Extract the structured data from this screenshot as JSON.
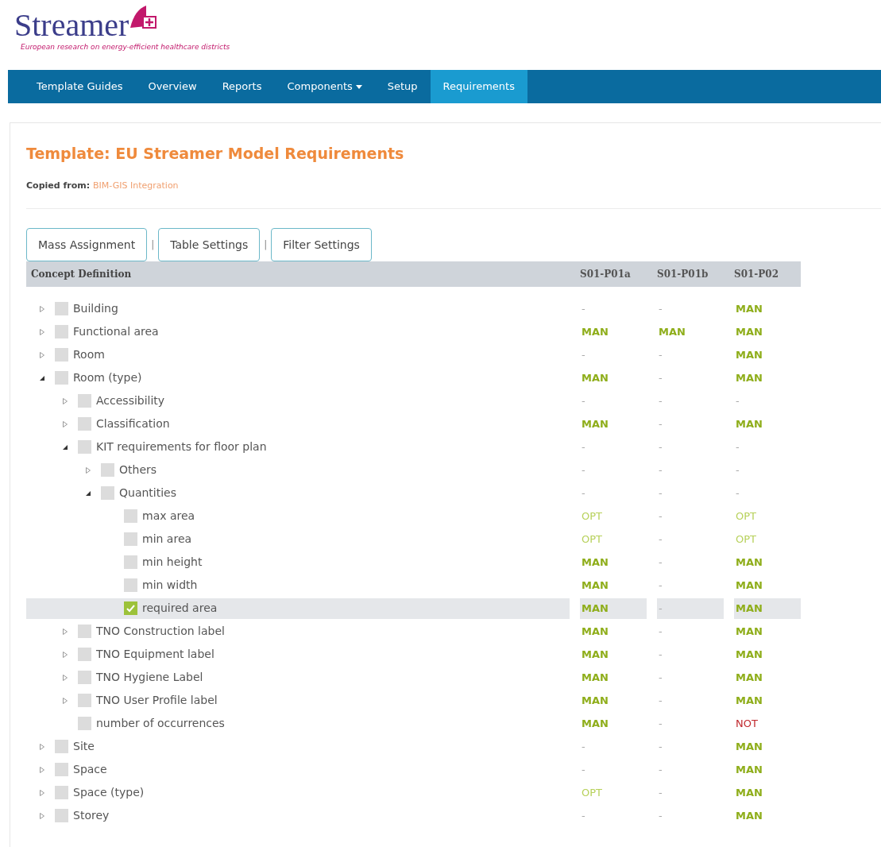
{
  "logo": {
    "name": "Streamer",
    "tagline": "European research on energy-efficient healthcare districts"
  },
  "nav": [
    {
      "label": "Template Guides",
      "selected": false,
      "dropdown": false
    },
    {
      "label": "Overview",
      "selected": false,
      "dropdown": false
    },
    {
      "label": "Reports",
      "selected": false,
      "dropdown": false
    },
    {
      "label": "Components",
      "selected": false,
      "dropdown": true
    },
    {
      "label": "Setup",
      "selected": false,
      "dropdown": false
    },
    {
      "label": "Requirements",
      "selected": true,
      "dropdown": false
    }
  ],
  "title": "Template: EU Streamer Model Requirements",
  "copied_from": {
    "label": "Copied from:",
    "value": "BIM-GIS Integration"
  },
  "buttons": [
    "Mass Assignment",
    "Table Settings",
    "Filter Settings"
  ],
  "separators": [
    "|",
    "|"
  ],
  "table": {
    "columns": [
      "Concept Definition",
      "S01-P01a",
      "S01-P01b",
      "S01-P02"
    ],
    "rows": [
      {
        "name": "Building",
        "kind": "branch",
        "expanded": false,
        "checked": false,
        "selected": false,
        "values": [
          {
            "text": "-",
            "kind": "none"
          },
          {
            "text": "-",
            "kind": "none"
          },
          {
            "text": "MAN",
            "kind": "man"
          }
        ]
      },
      {
        "name": "Functional area",
        "kind": "branch",
        "expanded": false,
        "checked": false,
        "selected": false,
        "values": [
          {
            "text": "MAN",
            "kind": "man"
          },
          {
            "text": "MAN",
            "kind": "man"
          },
          {
            "text": "MAN",
            "kind": "man"
          }
        ]
      },
      {
        "name": "Room",
        "kind": "branch",
        "expanded": false,
        "checked": false,
        "selected": false,
        "values": [
          {
            "text": "-",
            "kind": "none"
          },
          {
            "text": "-",
            "kind": "none"
          },
          {
            "text": "MAN",
            "kind": "man"
          }
        ]
      },
      {
        "name": "Room (type)",
        "kind": "branch",
        "expanded": true,
        "checked": false,
        "selected": false,
        "values": [
          {
            "text": "MAN",
            "kind": "man"
          },
          {
            "text": "-",
            "kind": "none"
          },
          {
            "text": "MAN",
            "kind": "man"
          }
        ],
        "children": [
          {
            "name": "Accessibility",
            "kind": "branch",
            "expanded": false,
            "checked": false,
            "selected": false,
            "values": [
              {
                "text": "-",
                "kind": "none"
              },
              {
                "text": "-",
                "kind": "none"
              },
              {
                "text": "-",
                "kind": "none"
              }
            ]
          },
          {
            "name": "Classification",
            "kind": "branch",
            "expanded": false,
            "checked": false,
            "selected": false,
            "values": [
              {
                "text": "MAN",
                "kind": "man"
              },
              {
                "text": "-",
                "kind": "none"
              },
              {
                "text": "MAN",
                "kind": "man"
              }
            ]
          },
          {
            "name": "KIT requirements for floor plan",
            "kind": "branch",
            "expanded": true,
            "checked": false,
            "selected": false,
            "values": [
              {
                "text": "-",
                "kind": "none"
              },
              {
                "text": "-",
                "kind": "none"
              },
              {
                "text": "-",
                "kind": "none"
              }
            ],
            "children": [
              {
                "name": "Others",
                "kind": "branch",
                "expanded": false,
                "checked": false,
                "selected": false,
                "values": [
                  {
                    "text": "-",
                    "kind": "none"
                  },
                  {
                    "text": "-",
                    "kind": "none"
                  },
                  {
                    "text": "-",
                    "kind": "none"
                  }
                ]
              },
              {
                "name": "Quantities",
                "kind": "branch",
                "expanded": true,
                "checked": false,
                "selected": false,
                "values": [
                  {
                    "text": "-",
                    "kind": "none"
                  },
                  {
                    "text": "-",
                    "kind": "none"
                  },
                  {
                    "text": "-",
                    "kind": "none"
                  }
                ],
                "children": [
                  {
                    "name": "max area",
                    "kind": "leaf",
                    "checked": false,
                    "selected": false,
                    "values": [
                      {
                        "text": "OPT",
                        "kind": "opt"
                      },
                      {
                        "text": "-",
                        "kind": "none"
                      },
                      {
                        "text": "OPT",
                        "kind": "opt"
                      }
                    ]
                  },
                  {
                    "name": "min area",
                    "kind": "leaf",
                    "checked": false,
                    "selected": false,
                    "values": [
                      {
                        "text": "OPT",
                        "kind": "opt"
                      },
                      {
                        "text": "-",
                        "kind": "none"
                      },
                      {
                        "text": "OPT",
                        "kind": "opt"
                      }
                    ]
                  },
                  {
                    "name": "min height",
                    "kind": "leaf",
                    "checked": false,
                    "selected": false,
                    "values": [
                      {
                        "text": "MAN",
                        "kind": "man"
                      },
                      {
                        "text": "-",
                        "kind": "none"
                      },
                      {
                        "text": "MAN",
                        "kind": "man"
                      }
                    ]
                  },
                  {
                    "name": "min width",
                    "kind": "leaf",
                    "checked": false,
                    "selected": false,
                    "values": [
                      {
                        "text": "MAN",
                        "kind": "man"
                      },
                      {
                        "text": "-",
                        "kind": "none"
                      },
                      {
                        "text": "MAN",
                        "kind": "man"
                      }
                    ]
                  },
                  {
                    "name": "required area",
                    "kind": "leaf",
                    "checked": true,
                    "selected": true,
                    "values": [
                      {
                        "text": "MAN",
                        "kind": "man"
                      },
                      {
                        "text": "-",
                        "kind": "none"
                      },
                      {
                        "text": "MAN",
                        "kind": "man"
                      }
                    ]
                  }
                ]
              }
            ]
          },
          {
            "name": "TNO Construction label",
            "kind": "branch",
            "expanded": false,
            "checked": false,
            "selected": false,
            "values": [
              {
                "text": "MAN",
                "kind": "man"
              },
              {
                "text": "-",
                "kind": "none"
              },
              {
                "text": "MAN",
                "kind": "man"
              }
            ]
          },
          {
            "name": "TNO Equipment label",
            "kind": "branch",
            "expanded": false,
            "checked": false,
            "selected": false,
            "values": [
              {
                "text": "MAN",
                "kind": "man"
              },
              {
                "text": "-",
                "kind": "none"
              },
              {
                "text": "MAN",
                "kind": "man"
              }
            ]
          },
          {
            "name": "TNO Hygiene Label",
            "kind": "branch",
            "expanded": false,
            "checked": false,
            "selected": false,
            "values": [
              {
                "text": "MAN",
                "kind": "man"
              },
              {
                "text": "-",
                "kind": "none"
              },
              {
                "text": "MAN",
                "kind": "man"
              }
            ]
          },
          {
            "name": "TNO User Profile label",
            "kind": "branch",
            "expanded": false,
            "checked": false,
            "selected": false,
            "values": [
              {
                "text": "MAN",
                "kind": "man"
              },
              {
                "text": "-",
                "kind": "none"
              },
              {
                "text": "MAN",
                "kind": "man"
              }
            ]
          },
          {
            "name": "number of occurrences",
            "kind": "leaf",
            "checked": false,
            "selected": false,
            "values": [
              {
                "text": "MAN",
                "kind": "man"
              },
              {
                "text": "-",
                "kind": "none"
              },
              {
                "text": "NOT",
                "kind": "not"
              }
            ]
          }
        ]
      },
      {
        "name": "Site",
        "kind": "branch",
        "expanded": false,
        "checked": false,
        "selected": false,
        "values": [
          {
            "text": "-",
            "kind": "none"
          },
          {
            "text": "-",
            "kind": "none"
          },
          {
            "text": "MAN",
            "kind": "man"
          }
        ]
      },
      {
        "name": "Space",
        "kind": "branch",
        "expanded": false,
        "checked": false,
        "selected": false,
        "values": [
          {
            "text": "-",
            "kind": "none"
          },
          {
            "text": "-",
            "kind": "none"
          },
          {
            "text": "MAN",
            "kind": "man"
          }
        ]
      },
      {
        "name": "Space (type)",
        "kind": "branch",
        "expanded": false,
        "checked": false,
        "selected": false,
        "values": [
          {
            "text": "OPT",
            "kind": "opt"
          },
          {
            "text": "-",
            "kind": "none"
          },
          {
            "text": "MAN",
            "kind": "man"
          }
        ]
      },
      {
        "name": "Storey",
        "kind": "branch",
        "expanded": false,
        "checked": false,
        "selected": false,
        "values": [
          {
            "text": "-",
            "kind": "none"
          },
          {
            "text": "-",
            "kind": "none"
          },
          {
            "text": "MAN",
            "kind": "man"
          }
        ]
      }
    ]
  }
}
